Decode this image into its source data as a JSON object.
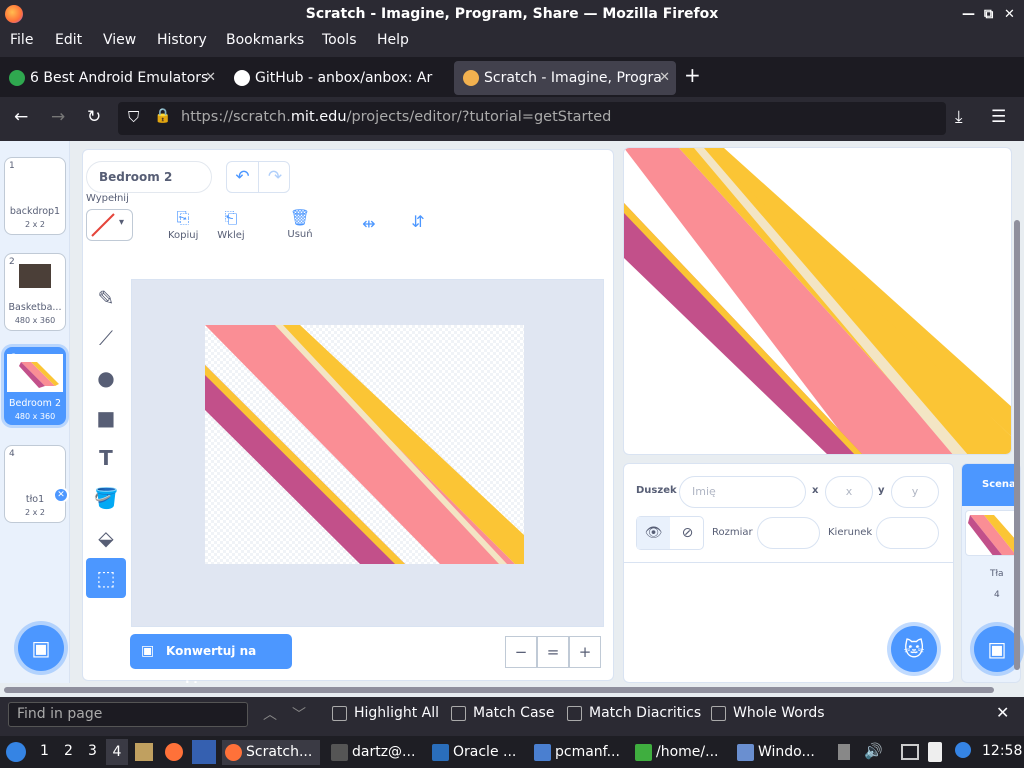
{
  "window": {
    "title": "Scratch - Imagine, Program, Share — Mozilla Firefox",
    "minimize": "—",
    "restore": "⧉",
    "close": "✕"
  },
  "menu": [
    "File",
    "Edit",
    "View",
    "History",
    "Bookmarks",
    "Tools",
    "Help"
  ],
  "tabs": [
    {
      "label": "6 Best Android Emulators",
      "active": false
    },
    {
      "label": "GitHub - anbox/anbox: Ar",
      "active": false
    },
    {
      "label": "Scratch - Imagine, Progra",
      "active": true
    }
  ],
  "url": {
    "prefix": "https://scratch.",
    "domain": "mit.edu",
    "path": "/projects/editor/?tutorial=getStarted"
  },
  "backdrops": [
    {
      "num": "1",
      "name": "backdrop1",
      "size": "2 x 2"
    },
    {
      "num": "2",
      "name": "Basketba...",
      "size": "480 x 360"
    },
    {
      "num": "3",
      "name": "Bedroom 2",
      "size": "480 x 360"
    },
    {
      "num": "4",
      "name": "tło1",
      "size": "2 x 2"
    }
  ],
  "editor": {
    "costume_name": "Bedroom 2",
    "fill_label": "Wypełnij",
    "copy": "Kopiuj",
    "paste": "Wklej",
    "delete": "Usuń",
    "convert": "Konwertuj na wektor",
    "zoom_out": "−",
    "zoom_reset": "=",
    "zoom_in": "+"
  },
  "sprite": {
    "label": "Duszek",
    "name_placeholder": "Imię",
    "x_label": "x",
    "x_placeholder": "x",
    "y_label": "y",
    "y_placeholder": "y",
    "size_label": "Rozmiar",
    "direction_label": "Kierunek"
  },
  "stage_panel": {
    "tab": "Scena",
    "backdrops_label": "Tła",
    "count": "4"
  },
  "find": {
    "placeholder": "Find in page",
    "highlight_all": "Highlight All",
    "match_case": "Match Case",
    "match_diacritics": "Match Diacritics",
    "whole_words": "Whole Words"
  },
  "taskbar": {
    "workspaces": [
      "1",
      "2",
      "3",
      "4"
    ],
    "tasks": [
      "Scratch...",
      "dartz@...",
      "Oracle ...",
      "pcmanf...",
      "/home/...",
      "Windo..."
    ],
    "clock": "12:58"
  },
  "colors": {
    "accent": "#4c97ff",
    "pink": "#fa8e95",
    "yellow": "#fbc535",
    "magenta": "#c2508a"
  }
}
